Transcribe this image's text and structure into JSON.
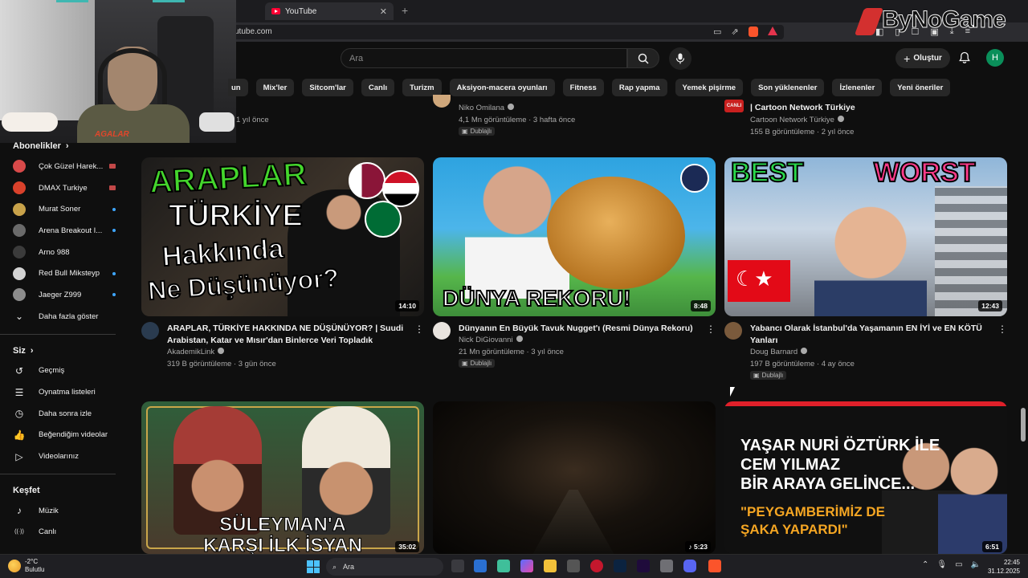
{
  "browser": {
    "tab_title": "YouTube",
    "url_text": "utube.com"
  },
  "webcam": {
    "brand_text": "AGALAR"
  },
  "watermark": {
    "text": "ByNoGame"
  },
  "header": {
    "search_placeholder": "Ara",
    "create_label": "Oluştur",
    "avatar_letter": "H"
  },
  "chips": [
    "un",
    "Mix'ler",
    "Sitcom'lar",
    "Canlı",
    "Turizm",
    "Aksiyon-macera oyunları",
    "Fitness",
    "Rap yapma",
    "Yemek pişirme",
    "Son yüklenenler",
    "İzlenenler",
    "Yeni öneriler"
  ],
  "sidebar": {
    "subscriptions_title": "Abonelikler",
    "subscriptions": [
      {
        "label": "Çok Güzel Harek...",
        "indicator": "live",
        "color": "#d84a4a"
      },
      {
        "label": "DMAX Turkiye",
        "indicator": "live",
        "color": "#d9412b"
      },
      {
        "label": "Murat Soner",
        "indicator": "dot",
        "color": "#c8a24a"
      },
      {
        "label": "Arena Breakout I...",
        "indicator": "dot",
        "color": "#6a6a6a"
      },
      {
        "label": "Arno 988",
        "indicator": "none",
        "color": "#3b3b3b"
      },
      {
        "label": "Red Bull Miksteyp",
        "indicator": "dot",
        "color": "#d3d3d3"
      },
      {
        "label": "Jaeger Z999",
        "indicator": "dot",
        "color": "#8c8c8c"
      }
    ],
    "show_more": "Daha fazla göster",
    "you_title": "Siz",
    "you_items": [
      {
        "label": "Geçmiş",
        "icon": "history-icon",
        "glyph": "↺"
      },
      {
        "label": "Oynatma listeleri",
        "icon": "playlist-icon",
        "glyph": "☰"
      },
      {
        "label": "Daha sonra izle",
        "icon": "clock-icon",
        "glyph": "◷"
      },
      {
        "label": "Beğendiğim videolar",
        "icon": "like-icon",
        "glyph": "👍"
      },
      {
        "label": "Videolarınız",
        "icon": "video-icon",
        "glyph": "▷"
      }
    ],
    "explore_title": "Keşfet",
    "explore_items": [
      {
        "label": "Müzik",
        "icon": "music-icon",
        "glyph": "♪"
      },
      {
        "label": "Canlı",
        "icon": "live-icon",
        "glyph": "((·))"
      }
    ]
  },
  "prev_row": {
    "left_stats": "1 yıl önce",
    "mid_channel": "Niko Omilana",
    "mid_stats": "4,1 Mn görüntüleme · 3 hafta önce",
    "mid_badge": "Dublajlı",
    "right_title": "| Cartoon Network Türkiye",
    "right_channel": "Cartoon Network Türkiye",
    "right_stats": "155 B görüntüleme · 2 yıl önce",
    "right_thumb_tag": "CANLI"
  },
  "videos": [
    {
      "title": "ARAPLAR, TÜRKİYE HAKKINDA NE DÜŞÜNÜYOR? | Suudi Arabistan, Katar ve Mısır'dan Binlerce Veri Topladık",
      "channel": "AkademikLink",
      "stats": "319 B görüntüleme · 3 gün önce",
      "duration": "14:10",
      "badge": "",
      "thumb_text": [
        "ARAPLAR",
        "TÜRKİYE",
        "Hakkında",
        "Ne Düşünüyor?"
      ]
    },
    {
      "title": "Dünyanın En Büyük Tavuk Nugget'ı (Resmi Dünya Rekoru)",
      "channel": "Nick DiGiovanni",
      "stats": "21 Mn görüntüleme · 3 yıl önce",
      "duration": "8:48",
      "badge": "Dublajlı",
      "thumb_text": [
        "DÜNYA REKORU!"
      ]
    },
    {
      "title": "Yabancı Olarak İstanbul'da Yaşamanın EN İYİ ve EN KÖTÜ Yanları",
      "channel": "Doug Barnard",
      "stats": "197 B görüntüleme · 4 ay önce",
      "duration": "12:43",
      "badge": "Dublajlı",
      "thumb_text": [
        "BEST",
        "WORST"
      ]
    },
    {
      "title": "",
      "channel": "",
      "stats": "",
      "duration": "35:02",
      "badge": "",
      "thumb_text": [
        "SÜLEYMAN'A",
        "KARŞI İLK İSYAN"
      ]
    },
    {
      "title": "",
      "channel": "",
      "stats": "",
      "duration": "5:23",
      "badge": "",
      "thumb_text": []
    },
    {
      "title": "",
      "channel": "",
      "stats": "",
      "duration": "6:51",
      "badge": "",
      "thumb_text": [
        "YAŞAR NURİ ÖZTÜRK İLE",
        "CEM YILMAZ",
        "BİR ARAYA GELİNCE...",
        "\"PEYGAMBERİMİZ DE",
        "ŞAKA YAPARDI\""
      ]
    }
  ],
  "taskbar": {
    "temperature": "-2°C",
    "weather_label": "Bulutlu",
    "search_label": "Ara",
    "time": "22:45",
    "date": "31.12.2025"
  },
  "colors": {
    "accent": "#ff0033",
    "avatar_bg": "#0a8f5a",
    "link": "#3ea6ff"
  }
}
